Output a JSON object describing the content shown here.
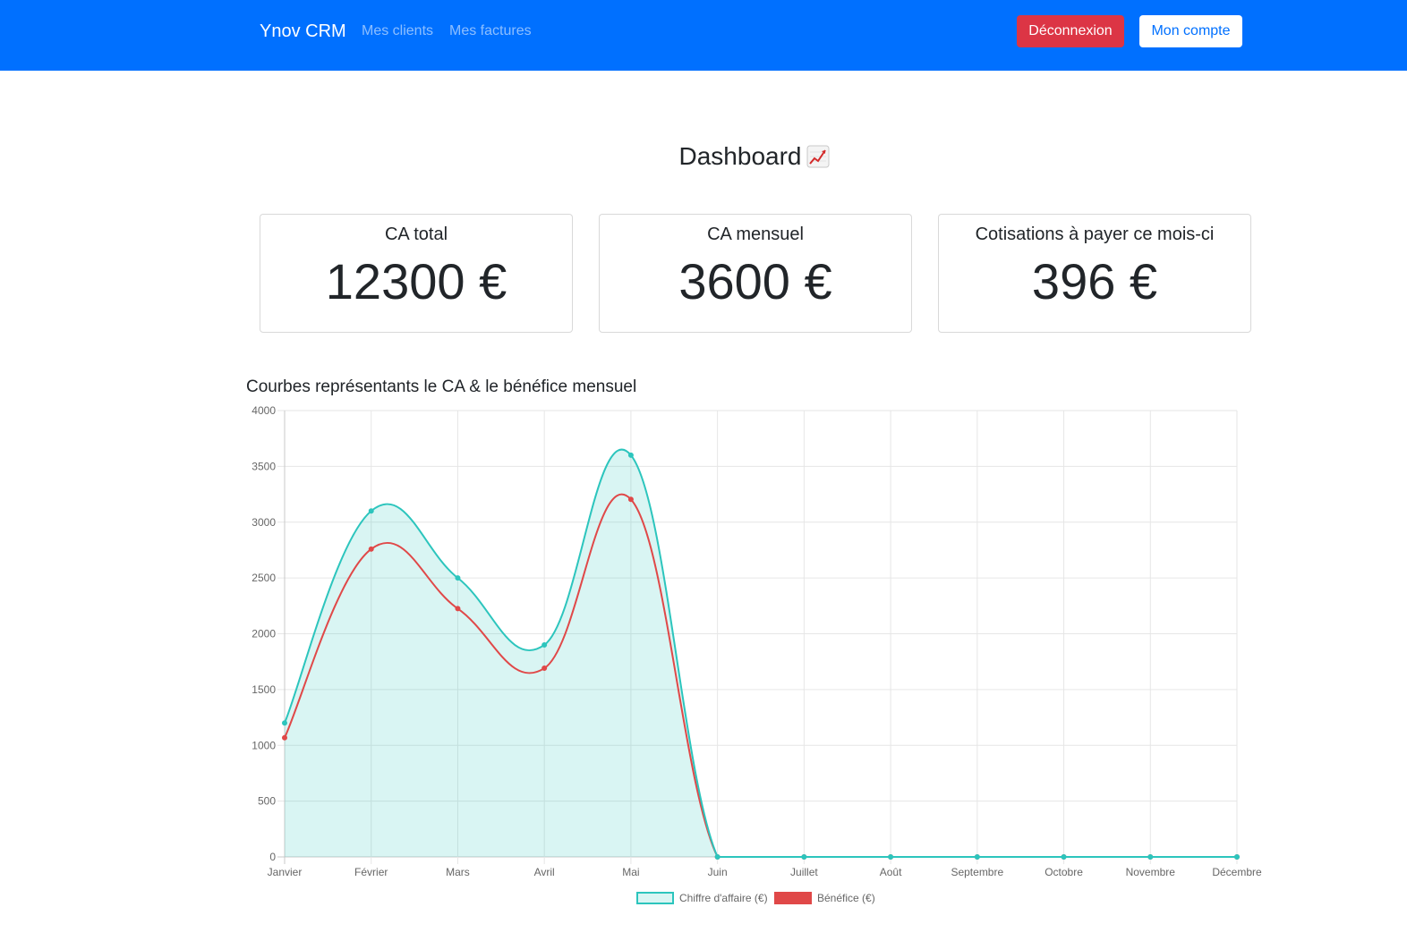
{
  "navbar": {
    "brand": "Ynov CRM",
    "links": [
      "Mes clients",
      "Mes factures"
    ],
    "logout_label": "Déconnexion",
    "account_label": "Mon compte",
    "colors": {
      "bar": "#0070ff",
      "logout": "#dc3545"
    }
  },
  "page": {
    "title": "Dashboard",
    "title_icon": "chart-increasing-icon"
  },
  "cards": [
    {
      "title": "CA total",
      "value": "12300 €"
    },
    {
      "title": "CA mensuel",
      "value": "3600 €"
    },
    {
      "title": "Cotisations à payer ce mois-ci",
      "value": "396 €"
    }
  ],
  "chart_title": "Courbes représentants le CA & le bénéfice mensuel",
  "chart_data": {
    "type": "line",
    "categories": [
      "Janvier",
      "Février",
      "Mars",
      "Avril",
      "Mai",
      "Juin",
      "Juillet",
      "Août",
      "Septembre",
      "Octobre",
      "Novembre",
      "Décembre"
    ],
    "ylim": [
      0,
      4000
    ],
    "yticks": [
      0,
      500,
      1000,
      1500,
      2000,
      2500,
      3000,
      3500,
      4000
    ],
    "grid": true,
    "legend_position": "bottom",
    "series": [
      {
        "name": "Chiffre d'affaire (€)",
        "values": [
          1200,
          3100,
          2500,
          1900,
          3600,
          0,
          0,
          0,
          0,
          0,
          0,
          0
        ],
        "color": "#2cc5bd",
        "fill": "rgba(44,197,189,0.18)"
      },
      {
        "name": "Bénéfice (€)",
        "values": [
          1068,
          2759,
          2225,
          1691,
          3204,
          0,
          0,
          0,
          0,
          0,
          0,
          0
        ],
        "color": "#e04848",
        "fill": "none"
      }
    ]
  }
}
